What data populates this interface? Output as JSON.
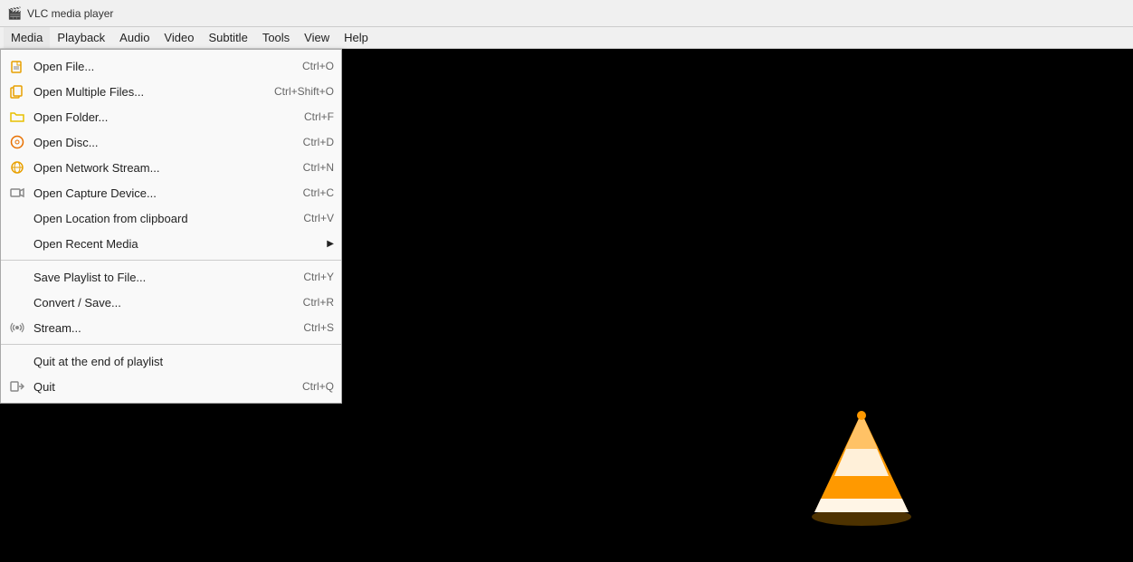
{
  "titleBar": {
    "icon": "🎬",
    "title": "VLC media player"
  },
  "menuBar": {
    "items": [
      {
        "id": "media",
        "label": "Media",
        "active": true
      },
      {
        "id": "playback",
        "label": "Playback"
      },
      {
        "id": "audio",
        "label": "Audio"
      },
      {
        "id": "video",
        "label": "Video"
      },
      {
        "id": "subtitle",
        "label": "Subtitle"
      },
      {
        "id": "tools",
        "label": "Tools"
      },
      {
        "id": "view",
        "label": "View"
      },
      {
        "id": "help",
        "label": "Help"
      }
    ]
  },
  "mediaMenu": {
    "items": [
      {
        "id": "open-file",
        "icon": "file",
        "label": "Open File...",
        "shortcut": "Ctrl+O",
        "hasSeparator": false
      },
      {
        "id": "open-multiple",
        "icon": "files",
        "label": "Open Multiple Files...",
        "shortcut": "Ctrl+Shift+O"
      },
      {
        "id": "open-folder",
        "icon": "folder",
        "label": "Open Folder...",
        "shortcut": "Ctrl+F"
      },
      {
        "id": "open-disc",
        "icon": "disc",
        "label": "Open Disc...",
        "shortcut": "Ctrl+D"
      },
      {
        "id": "open-network",
        "icon": "network",
        "label": "Open Network Stream...",
        "shortcut": "Ctrl+N"
      },
      {
        "id": "open-capture",
        "icon": "capture",
        "label": "Open Capture Device...",
        "shortcut": "Ctrl+C"
      },
      {
        "id": "open-location",
        "icon": "none",
        "label": "Open Location from clipboard",
        "shortcut": "Ctrl+V"
      },
      {
        "id": "open-recent",
        "icon": "none",
        "label": "Open Recent Media",
        "shortcut": "",
        "hasArrow": true,
        "hasSeparatorBefore": false,
        "hasSeparatorAfter": true
      },
      {
        "id": "save-playlist",
        "icon": "none",
        "label": "Save Playlist to File...",
        "shortcut": "Ctrl+Y"
      },
      {
        "id": "convert-save",
        "icon": "none",
        "label": "Convert / Save...",
        "shortcut": "Ctrl+R"
      },
      {
        "id": "stream",
        "icon": "stream",
        "label": "Stream...",
        "shortcut": "Ctrl+S",
        "hasSeparatorAfter": true
      },
      {
        "id": "quit-end",
        "icon": "none",
        "label": "Quit at the end of playlist",
        "shortcut": ""
      },
      {
        "id": "quit",
        "icon": "exit",
        "label": "Quit",
        "shortcut": "Ctrl+Q"
      }
    ]
  }
}
